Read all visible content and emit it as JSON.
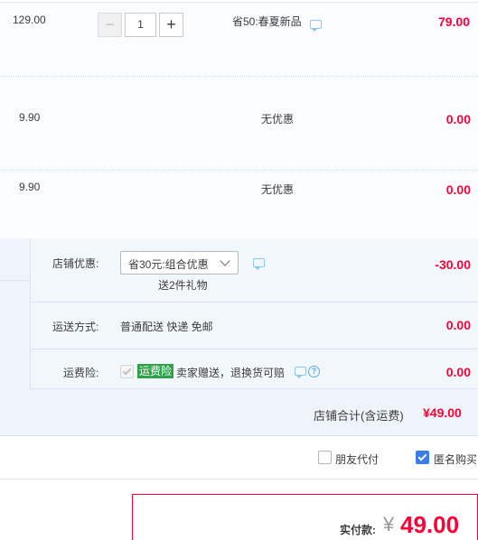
{
  "items": [
    {
      "price": "129.00",
      "quantity": "1",
      "promo": "省50:春夏新品",
      "amount": "79.00"
    },
    {
      "price": "9.90",
      "promo": "无优惠",
      "amount": "0.00"
    },
    {
      "price": "9.90",
      "promo": "无优惠",
      "amount": "0.00"
    }
  ],
  "qty_controls": {
    "minus": "−",
    "plus": "+"
  },
  "shop": {
    "discount_label": "店铺优惠:",
    "discount_selected": "省30元:组合优惠",
    "gift_note": "送2件礼物",
    "discount_amount": "-30.00",
    "shipping_label": "运送方式:",
    "shipping_value": "普通配送 快递 免邮",
    "shipping_amount": "0.00",
    "insurance_label": "运费险:",
    "insurance_badge": "运费险",
    "insurance_text": "卖家赠送，退换货可赔",
    "insurance_amount": "0.00",
    "total_label": "店铺合计(含运费)",
    "total_amount": "¥49.00"
  },
  "options": {
    "friend_pay": "朋友代付",
    "anonymous": "匿名购买"
  },
  "payment": {
    "label": "实付款:",
    "currency": "¥",
    "amount": "49.00"
  },
  "colors": {
    "accent_red": "#ff0036",
    "checkbox_blue": "#3b7cea",
    "badge_green": "#2fa14b"
  },
  "icons": [
    "chat-icon",
    "chevron-down-icon",
    "check-icon",
    "help-icon"
  ]
}
